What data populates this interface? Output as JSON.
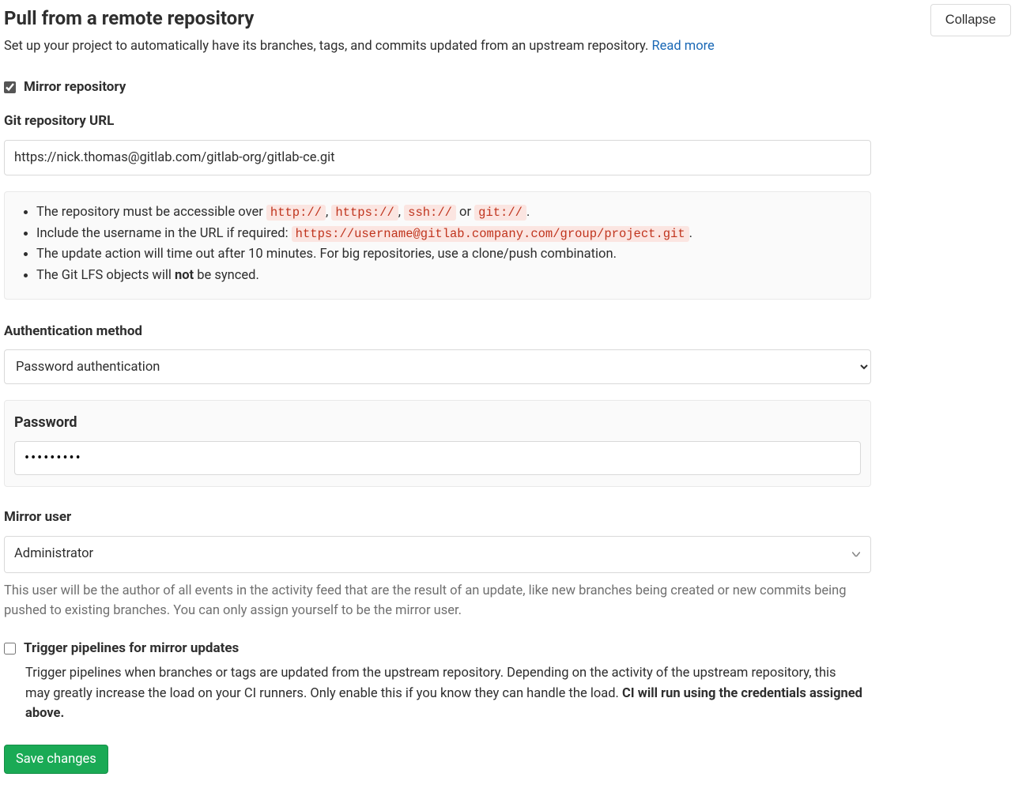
{
  "header": {
    "title": "Pull from a remote repository",
    "collapse_label": "Collapse",
    "description_pre": "Set up your project to automatically have its branches, tags, and commits updated from an upstream repository. ",
    "read_more_label": "Read more"
  },
  "mirror_checkbox": {
    "label": "Mirror repository",
    "checked": true
  },
  "repo_url": {
    "label": "Git repository URL",
    "value": "https://nick.thomas@gitlab.com/gitlab-org/gitlab-ce.git"
  },
  "info_box": {
    "bullet1_pre": "The repository must be accessible over ",
    "code_http": "http://",
    "sep_comma1": ", ",
    "code_https": "https://",
    "sep_comma2": ", ",
    "code_ssh": "ssh://",
    "sep_or": " or ",
    "code_git": "git://",
    "bullet1_post": ".",
    "bullet2_pre": "Include the username in the URL if required: ",
    "code_example": "https://username@gitlab.company.com/group/project.git",
    "bullet2_post": ".",
    "bullet3": "The update action will time out after 10 minutes. For big repositories, use a clone/push combination.",
    "bullet4_pre": "The Git LFS objects will ",
    "bullet4_bold": "not",
    "bullet4_post": " be synced."
  },
  "auth_method": {
    "label": "Authentication method",
    "selected": "Password authentication"
  },
  "password": {
    "label": "Password",
    "value": "•••••••••"
  },
  "mirror_user": {
    "label": "Mirror user",
    "selected": "Administrator",
    "help": "This user will be the author of all events in the activity feed that are the result of an update, like new branches being created or new commits being pushed to existing branches. You can only assign yourself to be the mirror user."
  },
  "trigger": {
    "label": "Trigger pipelines for mirror updates",
    "checked": false,
    "desc_pre": "Trigger pipelines when branches or tags are updated from the upstream repository. Depending on the activity of the upstream repository, this may greatly increase the load on your CI runners. Only enable this if you know they can handle the load. ",
    "desc_bold": "CI will run using the credentials assigned above."
  },
  "save_label": "Save changes"
}
